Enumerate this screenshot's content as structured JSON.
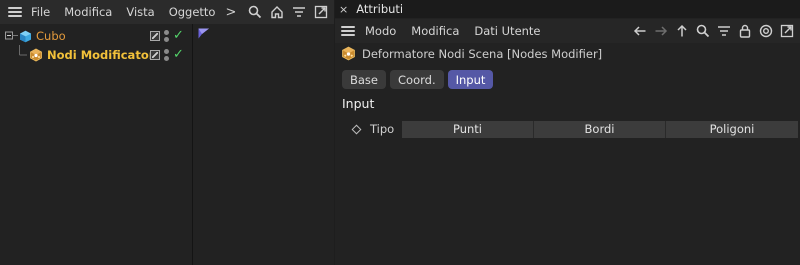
{
  "object_manager": {
    "menu": [
      "File",
      "Modifica",
      "Vista",
      "Oggetto"
    ],
    "more_chevron": ">",
    "toolbar_icons": [
      "search-icon",
      "home-icon",
      "filter-icon",
      "expand-icon"
    ],
    "objects": [
      {
        "name": "Cubo",
        "icon": "cube-icon",
        "color": "#e39a3c"
      },
      {
        "name": "Nodi Modificatori",
        "icon": "node-modifier-icon",
        "color": "#f2c13a"
      }
    ]
  },
  "attributes": {
    "tab_title": "Attributi",
    "close_symbol": "×",
    "menu": [
      "Modo",
      "Modifica",
      "Dati Utente"
    ],
    "toolbar_icons": [
      "back-arrow-icon",
      "forward-arrow-icon",
      "up-arrow-icon",
      "search-icon",
      "filter-icon",
      "lock-icon",
      "target-icon",
      "expand-icon"
    ],
    "object_title": "Deformatore Nodi Scena [Nodes Modifier]",
    "mode_tabs": [
      {
        "label": "Base",
        "active": false
      },
      {
        "label": "Coord.",
        "active": false
      },
      {
        "label": "Input",
        "active": true
      }
    ],
    "section_title": "Input",
    "param_label": "Tipo",
    "param_options": [
      "Punti",
      "Bordi",
      "Poligoni"
    ]
  },
  "colors": {
    "accent": "#5558a6",
    "check": "#54d56a",
    "object_orange": "#e39a3c",
    "object_yellow": "#f2c13a"
  }
}
